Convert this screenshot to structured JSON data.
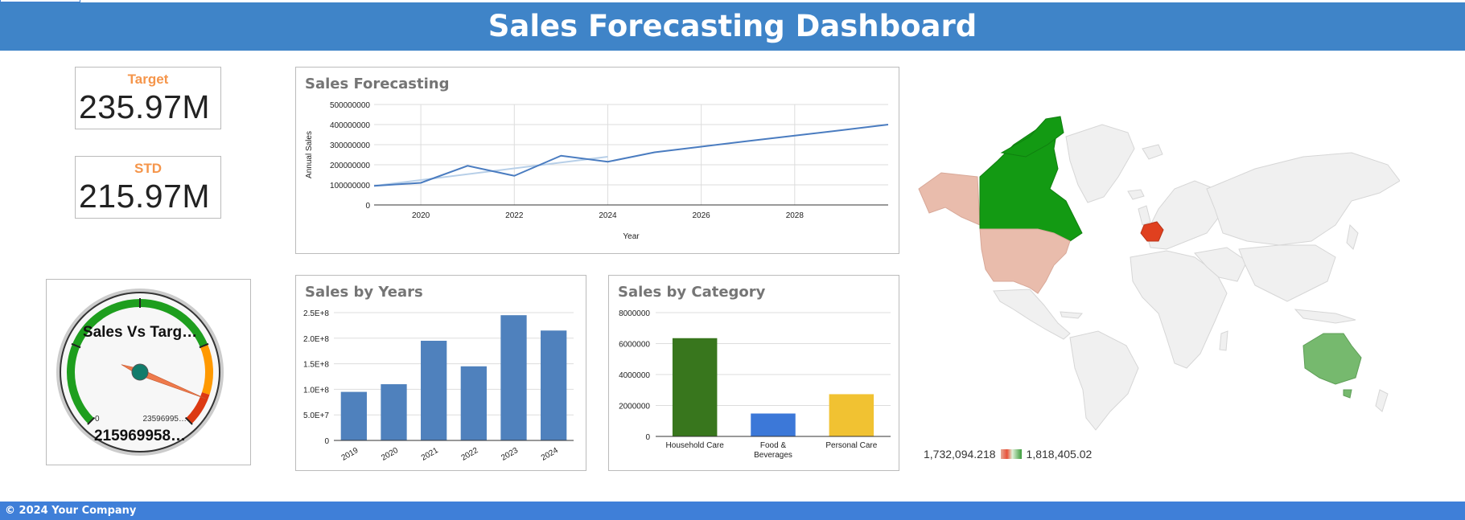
{
  "header": {
    "title": "Sales Forecasting Dashboard"
  },
  "kpis": {
    "target": {
      "label": "Target",
      "value": "235.97M"
    },
    "std": {
      "label": "STD",
      "value": "215.97M"
    }
  },
  "gauge": {
    "title": "Sales Vs Targ…",
    "min_label": "0",
    "max_label": "23596995…",
    "value_label": "215969958…",
    "value_fraction": 0.915,
    "zones": {
      "green": "#1e9e1e",
      "orange": "#ff9900",
      "red": "#dc3912"
    }
  },
  "sales_forecasting": {
    "title": "Sales Forecasting",
    "chart_data": {
      "type": "line",
      "title": "Sales Forecasting",
      "xlabel": "Year",
      "ylabel": "Annual Sales",
      "xlim": [
        2019,
        2030
      ],
      "ylim": [
        0,
        500000000
      ],
      "x_ticks": [
        "2020",
        "2022",
        "2024",
        "2026",
        "2028"
      ],
      "y_ticks": [
        "0",
        "100000000",
        "200000000",
        "300000000",
        "400000000",
        "500000000"
      ],
      "series": [
        {
          "x": [
            2019,
            2020,
            2021,
            2022,
            2023,
            2024,
            2025,
            2026,
            2027,
            2028,
            2029,
            2030
          ],
          "y": [
            95000000,
            110000000,
            195000000,
            145000000,
            245000000,
            215000000,
            262000000,
            290000000,
            318000000,
            345000000,
            372000000,
            400000000
          ],
          "color": "#4a7cc0"
        },
        {
          "x": [
            2019,
            2024
          ],
          "y": [
            95000000,
            240000000
          ],
          "color": "#b7cfe8"
        }
      ]
    }
  },
  "sales_by_years": {
    "title": "Sales by Years",
    "chart_data": {
      "type": "bar",
      "title": "Sales by Years",
      "categories": [
        "2019",
        "2020",
        "2021",
        "2022",
        "2023",
        "2024"
      ],
      "values": [
        95000000,
        110000000,
        195000000,
        145000000,
        245000000,
        215000000
      ],
      "ylim": [
        0,
        250000000
      ],
      "y_ticks": [
        "0",
        "5.0E+7",
        "1.0E+8",
        "1.5E+8",
        "2.0E+8",
        "2.5E+8"
      ],
      "color": "#4f81bd"
    }
  },
  "sales_by_category": {
    "title": "Sales by Category",
    "chart_data": {
      "type": "bar",
      "title": "Sales by Category",
      "categories": [
        "Household Care",
        "Food & Beverages",
        "Personal Care"
      ],
      "values": [
        6350000,
        1480000,
        2730000
      ],
      "colors": [
        "#38761d",
        "#3c78d8",
        "#f1c232"
      ],
      "ylim": [
        0,
        8000000
      ],
      "y_ticks": [
        "0",
        "2000000",
        "4000000",
        "6000000",
        "8000000"
      ]
    }
  },
  "map": {
    "legend_min": "1,732,094.218",
    "legend_max": "1,818,405.02",
    "highlighted": {
      "Canada": "#139a13",
      "United States": "#e9bcac",
      "Alaska": "#e9bcac",
      "France": "#e0401f",
      "Australia": "#76b96e",
      "Other": "#f0f0f0"
    }
  },
  "footer": {
    "text": "© 2024 Your Company"
  }
}
